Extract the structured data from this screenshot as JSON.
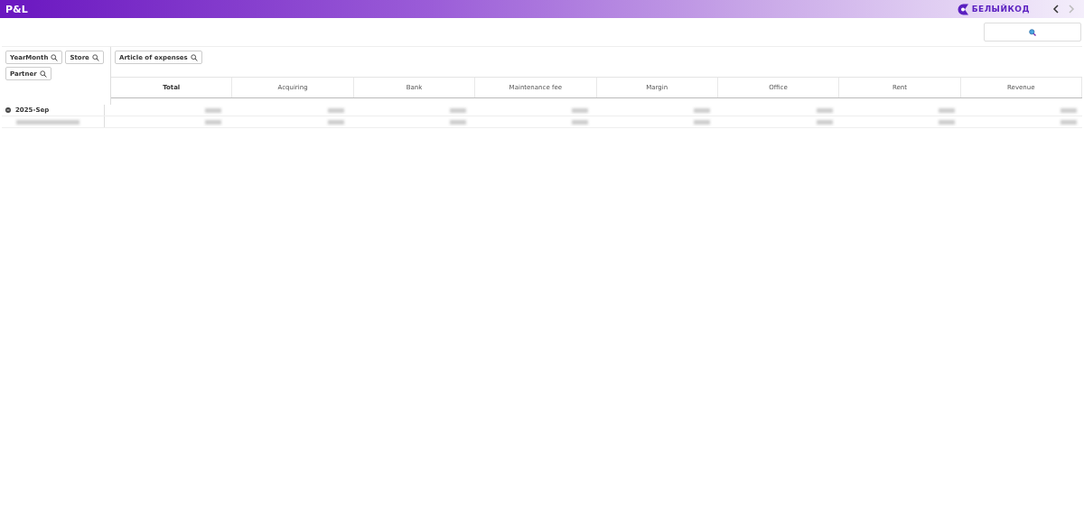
{
  "header": {
    "title": "P&L",
    "logo": "БЕЛЫЙКОД",
    "nav": [
      {
        "kind": "prev",
        "disabled": false
      },
      {
        "kind": "next",
        "disabled": true
      }
    ]
  },
  "row_dimensions": [
    "YearMonth",
    "Store",
    "Partner"
  ],
  "column_dimensions": [
    "Article of expenses"
  ],
  "table": {
    "columns": [
      "Total",
      "Acquiring",
      "Bank",
      "Maintenance fee",
      "Margin",
      "Office",
      "Rent",
      "Revenue"
    ],
    "rows": [
      {
        "label": "2025-Sep",
        "expanded": true,
        "kind": "group"
      },
      {
        "kind": "child"
      }
    ]
  }
}
